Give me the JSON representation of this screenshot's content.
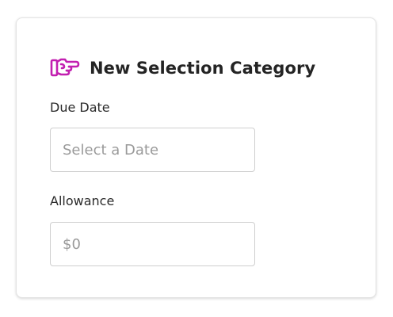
{
  "header": {
    "icon": "pointing-hand-icon",
    "icon_color": "#c21fb0",
    "title": "New Selection Category"
  },
  "fields": {
    "due_date": {
      "label": "Due Date",
      "placeholder": "Select a Date",
      "value": ""
    },
    "allowance": {
      "label": "Allowance",
      "placeholder": "$0",
      "value": ""
    }
  }
}
